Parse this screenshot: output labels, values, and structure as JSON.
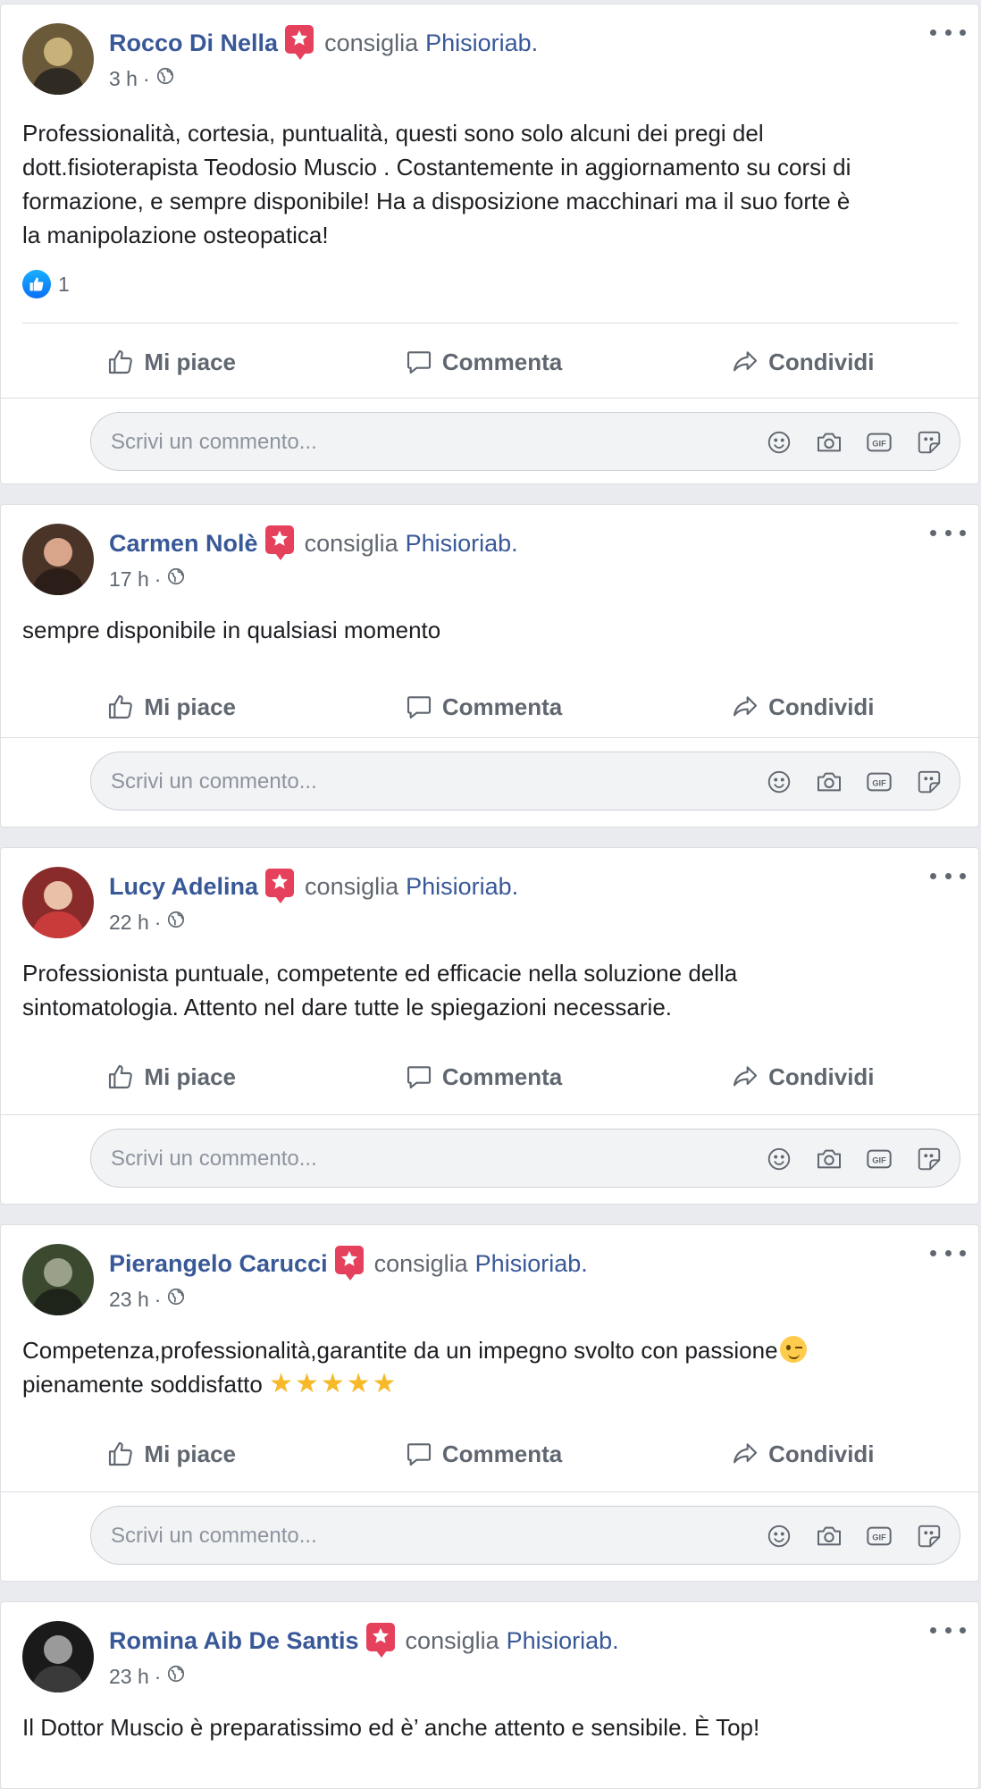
{
  "common": {
    "verb": "consiglia",
    "page": "Phisioriab.",
    "like_label": "Mi piace",
    "comment_label": "Commenta",
    "share_label": "Condividi",
    "comment_placeholder": "Scrivi un commento...",
    "icons": [
      "emoji-icon",
      "camera-icon",
      "gif-icon",
      "sticker-icon"
    ],
    "colors": {
      "link": "#385898",
      "badge": "#e5415c",
      "meta": "#606770"
    }
  },
  "posts": [
    {
      "author": "Rocco Di Nella",
      "time": "3 h",
      "text": [
        "Professionalità, cortesia, puntualità, questi sono solo alcuni dei pregi del",
        "dott.fisioterapista Teodosio Muscio . Costantemente in aggiornamento su corsi di",
        "formazione, e sempre disponibile! Ha a disposizione macchinari ma il suo forte è",
        "la manipolazione osteopatica!"
      ],
      "reactions": "1"
    },
    {
      "author": "Carmen Nolè",
      "time": "17 h",
      "text": [
        "sempre disponibile in qualsiasi momento"
      ]
    },
    {
      "author": "Lucy Adelina",
      "time": "22 h",
      "text": [
        "Professionista puntuale, competente ed efficacie nella soluzione della",
        "sintomatologia. Attento nel dare tutte le spiegazioni necessarie."
      ]
    },
    {
      "author": "Pierangelo Carucci",
      "time": "23 h",
      "text": [
        "Competenza,professionalità,garantite da un impegno svolto con passione",
        "pienamente soddisfatto"
      ],
      "stars": "★★★★★"
    },
    {
      "author": "Romina Aib De Santis",
      "time": "23 h",
      "text": [
        "Il Dottor Muscio è preparatissimo ed è’ anche attento e sensibile. È Top!"
      ]
    }
  ]
}
